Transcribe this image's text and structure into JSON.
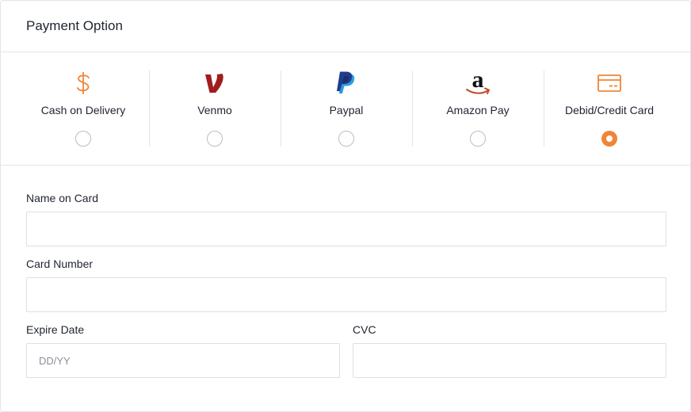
{
  "header": {
    "title": "Payment Option"
  },
  "payment_options": [
    {
      "label": "Cash on Delivery",
      "icon": "dollar-icon",
      "selected": false
    },
    {
      "label": "Venmo",
      "icon": "venmo-icon",
      "selected": false
    },
    {
      "label": "Paypal",
      "icon": "paypal-icon",
      "selected": false
    },
    {
      "label": "Amazon Pay",
      "icon": "amazon-icon",
      "selected": false
    },
    {
      "label": "Debid/Credit Card",
      "icon": "credit-card-icon",
      "selected": true
    }
  ],
  "form": {
    "name_label": "Name on Card",
    "name_value": "",
    "number_label": "Card Number",
    "number_value": "",
    "expire_label": "Expire Date",
    "expire_placeholder": "DD/YY",
    "cvc_label": "CVC",
    "cvc_value": ""
  },
  "colors": {
    "accent": "#f08537",
    "venmo": "#a11d1d",
    "paypal_dark": "#1f3d8f",
    "paypal_light": "#2c9be0"
  }
}
